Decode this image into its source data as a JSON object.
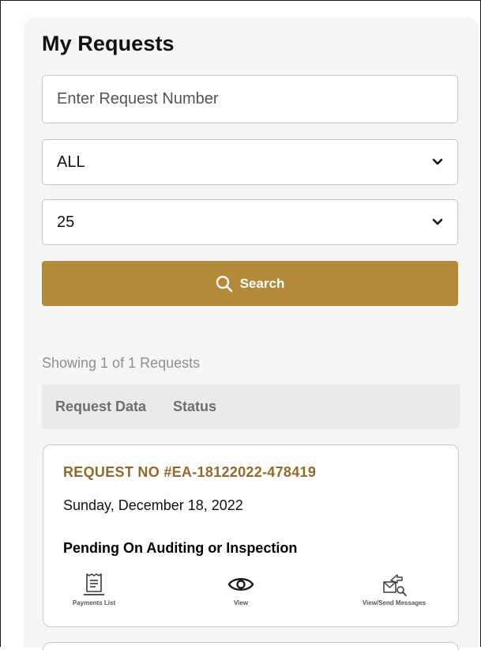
{
  "page": {
    "title": "My Requests"
  },
  "filters": {
    "request_number_placeholder": "Enter Request Number",
    "status_selected": "ALL",
    "page_size_selected": "25",
    "search_label": "Search"
  },
  "results": {
    "summary": "Showing 1 of 1 Requests",
    "columns": [
      "Request Data",
      "Status"
    ]
  },
  "requests": [
    {
      "number": "REQUEST NO #EA-18122022-478419",
      "date": "Sunday, December 18, 2022",
      "status": "Pending On Auditing or Inspection",
      "actions": {
        "payments": "Payments List",
        "view": "View",
        "messages": "View/Send Messages"
      }
    }
  ],
  "icons": {
    "search": "search-icon",
    "chevron": "chevron-down-icon",
    "payments": "receipt-icon",
    "view": "eye-icon",
    "messages": "envelope-search-icon"
  },
  "colors": {
    "accent": "#b38a3a",
    "request_number": "#916a2a",
    "panel": "#f5f5f5",
    "table_header": "#e9ebeb"
  }
}
